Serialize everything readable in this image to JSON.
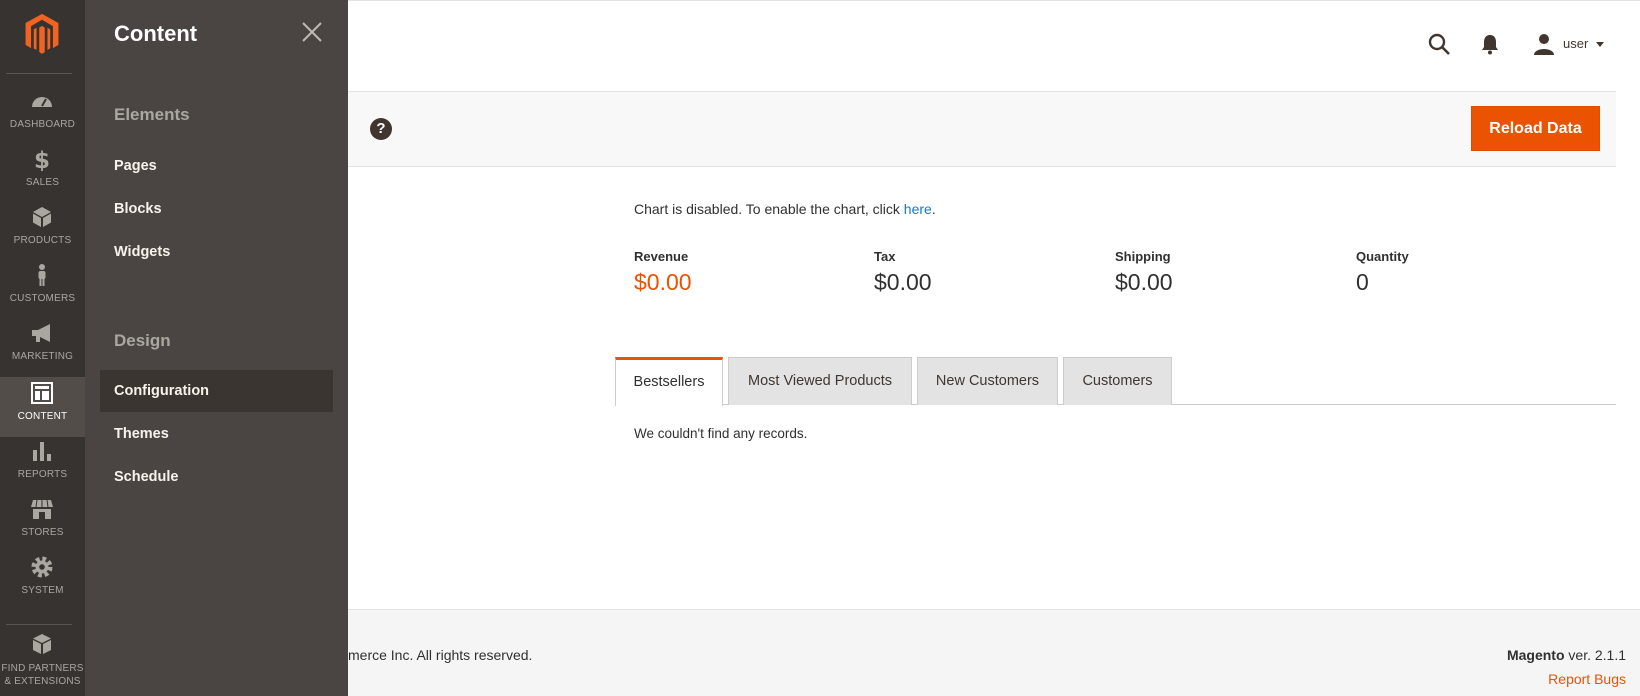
{
  "nav": {
    "items": [
      {
        "label": "DASHBOARD",
        "icon": "dashboard-icon"
      },
      {
        "label": "SALES",
        "icon": "dollar-icon"
      },
      {
        "label": "PRODUCTS",
        "icon": "box-icon"
      },
      {
        "label": "CUSTOMERS",
        "icon": "person-icon"
      },
      {
        "label": "MARKETING",
        "icon": "megaphone-icon"
      },
      {
        "label": "CONTENT",
        "icon": "layout-icon"
      },
      {
        "label": "REPORTS",
        "icon": "bar-chart-icon"
      },
      {
        "label": "STORES",
        "icon": "storefront-icon"
      },
      {
        "label": "SYSTEM",
        "icon": "gear-icon"
      },
      {
        "label_line1": "FIND PARTNERS",
        "label_line2": "& EXTENSIONS",
        "icon": "cube-icon"
      }
    ],
    "active": "CONTENT"
  },
  "flyout": {
    "title": "Content",
    "sections": [
      {
        "heading": "Elements",
        "links": [
          "Pages",
          "Blocks",
          "Widgets"
        ]
      },
      {
        "heading": "Design",
        "links": [
          "Configuration",
          "Themes",
          "Schedule"
        ]
      }
    ],
    "active_link": "Configuration"
  },
  "header": {
    "user_name": "user",
    "icons": [
      "search-icon",
      "bell-icon",
      "user-icon"
    ]
  },
  "action_bar": {
    "reload_label": "Reload Data",
    "help_glyph": "?"
  },
  "dashboard": {
    "chart_message": "Chart is disabled. To enable the chart, click ",
    "chart_link": "here",
    "chart_message_end": ".",
    "totals": [
      {
        "label": "Revenue",
        "value": "$0.00"
      },
      {
        "label": "Tax",
        "value": "$0.00"
      },
      {
        "label": "Shipping",
        "value": "$0.00"
      },
      {
        "label": "Quantity",
        "value": "0"
      }
    ],
    "tabs": [
      "Bestsellers",
      "Most Viewed Products",
      "New Customers",
      "Customers"
    ],
    "active_tab": "Bestsellers",
    "empty_message": "We couldn't find any records."
  },
  "footer": {
    "copyright": "merce Inc. All rights reserved.",
    "brand": "Magento",
    "version": " ver. 2.1.1",
    "report_bugs": "Report Bugs"
  },
  "colors": {
    "accent": "#eb5202",
    "nav_bg": "#373330",
    "flyout_bg": "#4a4542",
    "link": "#1979c3"
  }
}
